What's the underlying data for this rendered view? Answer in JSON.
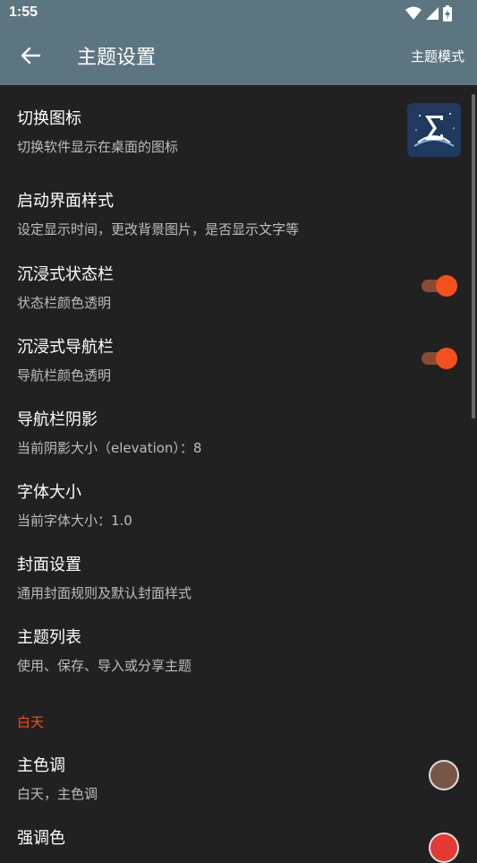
{
  "status_bar": {
    "time": "1:55"
  },
  "app_bar": {
    "title": "主题设置",
    "action_label": "主题模式"
  },
  "items": [
    {
      "title": "切换图标",
      "summary": "切换软件显示在桌面的图标"
    },
    {
      "title": "启动界面样式",
      "summary": "设定显示时间，更改背景图片，是否显示文字等"
    },
    {
      "title": "沉浸式状态栏",
      "summary": "状态栏颜色透明",
      "switch_on": true
    },
    {
      "title": "沉浸式导航栏",
      "summary": "导航栏颜色透明",
      "switch_on": true
    },
    {
      "title": "导航栏阴影",
      "summary": "当前阴影大小（elevation）：8"
    },
    {
      "title": "字体大小",
      "summary": "当前字体大小：1.0"
    },
    {
      "title": "封面设置",
      "summary": "通用封面规则及默认封面样式"
    },
    {
      "title": "主题列表",
      "summary": "使用、保存、导入或分享主题"
    }
  ],
  "section_day": {
    "header": "白天"
  },
  "day_items": [
    {
      "title": "主色调",
      "summary": "白天，主色调",
      "color": "#795548"
    },
    {
      "title": "强调色",
      "color": "#e53935"
    }
  ],
  "colors": {
    "app_bar": "#5d7580",
    "background": "#212121",
    "accent": "#f4511e"
  },
  "icons": {
    "back": "arrow-left-icon",
    "app_icon": "sigma-book-icon"
  }
}
